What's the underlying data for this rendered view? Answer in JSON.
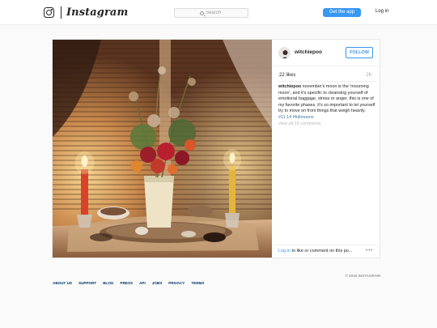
{
  "header": {
    "wordmark": "Instagram",
    "search_placeholder": "Search",
    "get_app_label": "Get the app",
    "login_label": "Log in"
  },
  "post": {
    "username": "witchiepoo",
    "follow_label": "FOLLOW",
    "likes": "22 likes",
    "age": "2h",
    "caption_user": "witchiepoo",
    "caption_text": " november's moon is the 'mourning moon', and it's specific to cleansing yourself of emotional baggage, stress or anger. this is one of my favorite phases, it's so important to let yourself try to move on from things that weigh heavily. ",
    "caption_tags": "#11.14 #fullmoons",
    "view_all_comments": "view all 15 comments",
    "comment_prompt_link": "Log in",
    "comment_prompt_text": " to like or comment on this po...",
    "more_icon": "more-horizontal-icon"
  },
  "footer": {
    "links": [
      "ABOUT US",
      "SUPPORT",
      "BLOG",
      "PRESS",
      "API",
      "JOBS",
      "PRIVACY",
      "TERMS"
    ],
    "copyright": "© 2016 INSTAGRAM"
  },
  "colors": {
    "accent": "#3897f0",
    "hashtag": "#3f729b",
    "footer_link": "#003569"
  }
}
